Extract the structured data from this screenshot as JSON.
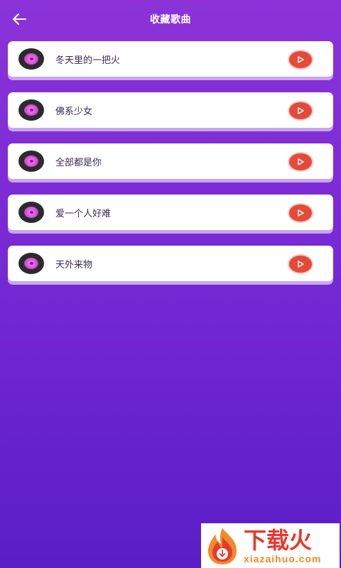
{
  "header": {
    "title": "收藏歌曲",
    "back_icon": "arrow-left-icon"
  },
  "colors": {
    "background_top": "#8b33d9",
    "background_bottom": "#5a1ec6",
    "play_button": "#e44a3a",
    "card": "#ffffff"
  },
  "songs": [
    {
      "name": "冬天里的一把火"
    },
    {
      "name": "佛系少女"
    },
    {
      "name": "全部都是你"
    },
    {
      "name": "爱一个人好难"
    },
    {
      "name": "天外来物"
    }
  ],
  "watermark": {
    "text_cn": "下载火",
    "text_en": "xiazaihuo.com"
  }
}
